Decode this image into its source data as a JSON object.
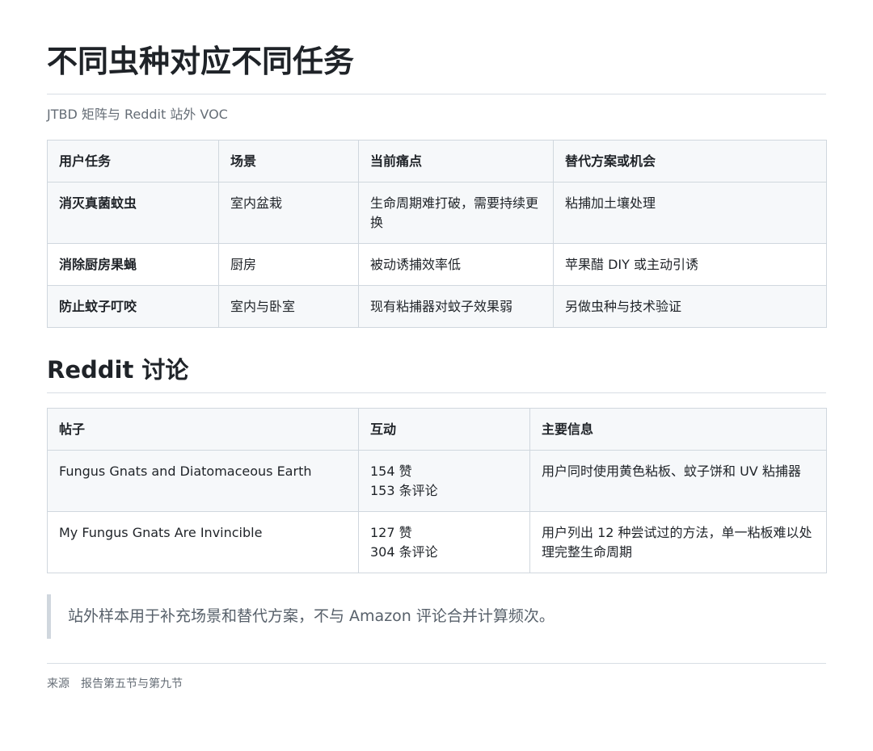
{
  "header": {
    "title": "不同虫种对应不同任务",
    "subtitle": "JTBD 矩阵与 Reddit 站外 VOC"
  },
  "jtbd_table": {
    "headers": [
      "用户任务",
      "场景",
      "当前痛点",
      "替代方案或机会"
    ],
    "rows": [
      [
        "消灭真菌蚊虫",
        "室内盆栽",
        "生命周期难打破，需要持续更换",
        "粘捕加土壤处理"
      ],
      [
        "消除厨房果蝇",
        "厨房",
        "被动诱捕效率低",
        "苹果醋 DIY 或主动引诱"
      ],
      [
        "防止蚊子叮咬",
        "室内与卧室",
        "现有粘捕器对蚊子效果弱",
        "另做虫种与技术验证"
      ]
    ]
  },
  "reddit": {
    "heading": "Reddit 讨论",
    "headers": [
      "帖子",
      "互动",
      "主要信息"
    ],
    "rows": [
      {
        "post": "Fungus Gnats and Diatomaceous Earth",
        "likes": "154 赞",
        "comments": "153 条评论",
        "info": "用户同时使用黄色粘板、蚊子饼和 UV 粘捕器"
      },
      {
        "post": "My Fungus Gnats Are Invincible",
        "likes": "127 赞",
        "comments": "304 条评论",
        "info": "用户列出 12 种尝试过的方法，单一粘板难以处理完整生命周期"
      }
    ]
  },
  "note": "站外样本用于补充场景和替代方案，不与 Amazon 评论合并计算频次。",
  "footer": {
    "label": "来源",
    "text": "报告第五节与第九节"
  }
}
